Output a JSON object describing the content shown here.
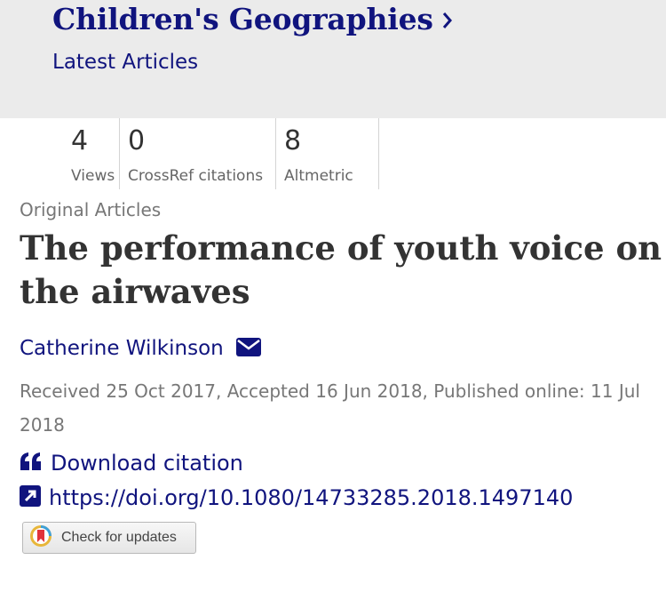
{
  "header": {
    "journal_title": "Children's Geographies",
    "subtitle": "Latest Articles"
  },
  "metrics": [
    {
      "value": "4",
      "label": "Views"
    },
    {
      "value": "0",
      "label": "CrossRef citations"
    },
    {
      "value": "8",
      "label": "Altmetric"
    }
  ],
  "article": {
    "section": "Original Articles",
    "title": "The performance of youth voice on the airwaves",
    "author": "Catherine Wilkinson",
    "dates": "Received 25 Oct 2017, Accepted 16 Jun 2018, Published online: 11 Jul 2018"
  },
  "actions": {
    "download_citation": "Download citation",
    "doi": "https://doi.org/10.1080/14733285.2018.1497140",
    "check_updates": "Check for updates"
  },
  "icons": {
    "journal_link": "chevron-right-icon",
    "author_contact": "envelope-icon",
    "citation": "quote-icon",
    "doi": "external-link-icon",
    "updates": "crossmark-icon"
  },
  "colors": {
    "brand": "#10147e",
    "header_bg": "#ebebeb",
    "muted_text": "#777777"
  }
}
